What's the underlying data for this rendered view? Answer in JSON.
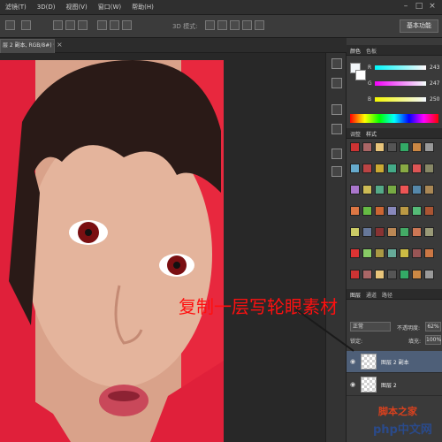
{
  "menu": {
    "items": [
      "滤镜(T)",
      "3D(D)",
      "视图(V)",
      "窗口(W)",
      "帮助(H)"
    ],
    "window_controls": [
      "–",
      "□",
      "×"
    ]
  },
  "options_bar": {
    "mode_label": "3D 模式:",
    "workspace_button": "基本功能"
  },
  "document_tab": {
    "title": "层 2 副本, RGB/8#) *",
    "close": "×"
  },
  "color_panel": {
    "tabs": [
      "颜色",
      "色板"
    ],
    "sliders": [
      {
        "label": "R",
        "value": "243",
        "color": "#f3f3f3"
      },
      {
        "label": "G",
        "value": "247",
        "color": "#f7f7f7"
      },
      {
        "label": "B",
        "value": "250",
        "color": "#fafafa"
      }
    ]
  },
  "styles_panel": {
    "tabs": [
      "调整",
      "样式"
    ]
  },
  "layers_panel": {
    "tabs": [
      "图层",
      "通道",
      "路径"
    ],
    "blend_mode": "正常",
    "opacity_label": "不透明度:",
    "opacity_value": "62%",
    "lock_label": "锁定:",
    "fill_label": "填充:",
    "fill_value": "100%",
    "layers": [
      {
        "name": "图层 2 副本",
        "selected": true
      },
      {
        "name": "图层 2",
        "selected": false
      }
    ]
  },
  "annotation": {
    "text": "复制一层写轮眼素材",
    "color": "#ff1010"
  },
  "watermark": {
    "line1": "脚本之家",
    "line2": "php中文网"
  }
}
